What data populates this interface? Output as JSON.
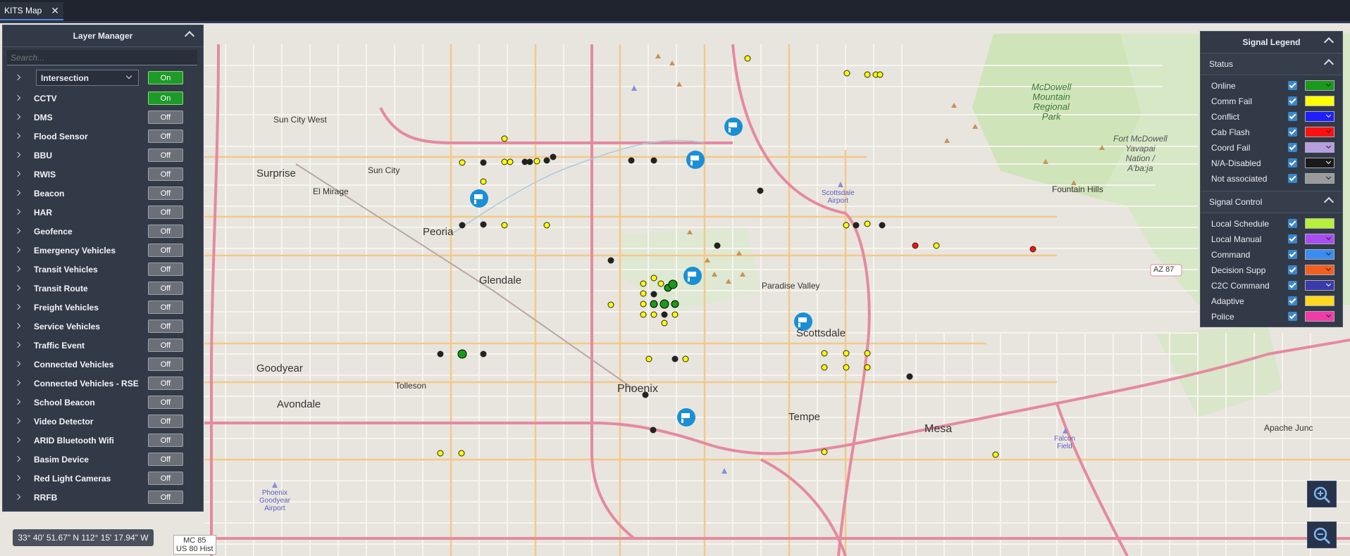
{
  "tab": {
    "title": "KITS Map",
    "close": "✕"
  },
  "layer_manager": {
    "title": "Layer Manager",
    "search_placeholder": "Search...",
    "intersection_select": "Intersection",
    "layers": [
      {
        "label": "Intersection",
        "state": "On"
      },
      {
        "label": "CCTV",
        "state": "On"
      },
      {
        "label": "DMS",
        "state": "Off"
      },
      {
        "label": "Flood Sensor",
        "state": "Off"
      },
      {
        "label": "BBU",
        "state": "Off"
      },
      {
        "label": "RWIS",
        "state": "Off"
      },
      {
        "label": "Beacon",
        "state": "Off"
      },
      {
        "label": "HAR",
        "state": "Off"
      },
      {
        "label": "Geofence",
        "state": "Off"
      },
      {
        "label": "Emergency Vehicles",
        "state": "Off"
      },
      {
        "label": "Transit Vehicles",
        "state": "Off"
      },
      {
        "label": "Transit Route",
        "state": "Off"
      },
      {
        "label": "Freight Vehicles",
        "state": "Off"
      },
      {
        "label": "Service Vehicles",
        "state": "Off"
      },
      {
        "label": "Traffic Event",
        "state": "Off"
      },
      {
        "label": "Connected Vehicles",
        "state": "Off"
      },
      {
        "label": "Connected Vehicles - RSE",
        "state": "Off"
      },
      {
        "label": "School Beacon",
        "state": "Off"
      },
      {
        "label": "Video Detector",
        "state": "Off"
      },
      {
        "label": "ARID Bluetooth Wifi",
        "state": "Off"
      },
      {
        "label": "Basim Device",
        "state": "Off"
      },
      {
        "label": "Red Light Cameras",
        "state": "Off"
      },
      {
        "label": "RRFB",
        "state": "Off"
      }
    ]
  },
  "legend": {
    "title": "Signal Legend",
    "status_title": "Status",
    "status": [
      {
        "label": "Online",
        "color": "#1a9a1a",
        "dropdown": true
      },
      {
        "label": "Comm Fail",
        "color": "#ffff00",
        "dropdown": false
      },
      {
        "label": "Conflict",
        "color": "#1e1eff",
        "dropdown": true
      },
      {
        "label": "Cab Flash",
        "color": "#ff1010",
        "dropdown": true
      },
      {
        "label": "Coord Fail",
        "color": "#b79ee0",
        "dropdown": true
      },
      {
        "label": "N/A-Disabled",
        "color": "#1a1a1a",
        "dropdown": true
      },
      {
        "label": "Not associated",
        "color": "#9a9a9a",
        "dropdown": true
      }
    ],
    "control_title": "Signal Control",
    "control": [
      {
        "label": "Local Schedule",
        "color": "#b6f03c",
        "dropdown": false
      },
      {
        "label": "Local Manual",
        "color": "#a84ef0",
        "dropdown": true
      },
      {
        "label": "Command",
        "color": "#3a8cf0",
        "dropdown": true
      },
      {
        "label": "Decision Supp",
        "color": "#f06020",
        "dropdown": true
      },
      {
        "label": "C2C Command",
        "color": "#3a3aa8",
        "dropdown": true
      },
      {
        "label": "Adaptive",
        "color": "#ffd820",
        "dropdown": false
      },
      {
        "label": "Police",
        "color": "#f03ca8",
        "dropdown": true
      }
    ]
  },
  "coordinates": "33° 40' 51.67\" N 112° 15' 17.94\" W",
  "map_labels": {
    "cities": [
      "Surprise",
      "Sun City",
      "Sun City West",
      "El Mirage",
      "Peoria",
      "Glendale",
      "Goodyear",
      "Avondale",
      "Tolleson",
      "Phoenix",
      "Tempe",
      "Mesa",
      "Scottsdale",
      "Paradise Valley",
      "Fountain Hills",
      "Apache Junc"
    ],
    "parks": [
      "McDowell",
      "Mountain",
      "Regional",
      "Park",
      "Fort McDowell",
      "Yavapai",
      "Nation /",
      "A'ba:ja"
    ],
    "airports": [
      "Scottsdale",
      "Airport",
      "Falcon",
      "Field",
      "Phoenix",
      "Goodyear",
      "Airport"
    ],
    "roads": [
      "AZ 87",
      "MC 85",
      "US 80 Hist"
    ]
  },
  "icons": {
    "zoom_in": "zoom-in-icon",
    "zoom_out": "zoom-out-icon",
    "camera": "camera-icon"
  }
}
